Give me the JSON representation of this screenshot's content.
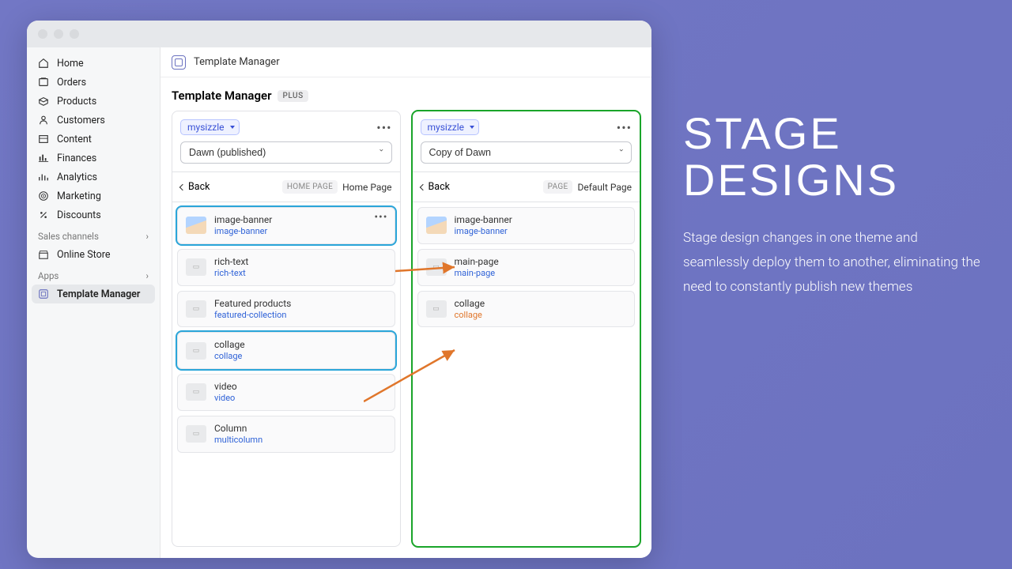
{
  "header": {
    "appName": "Template Manager"
  },
  "subheader": {
    "title": "Template Manager",
    "badge": "PLUS"
  },
  "sidebar": {
    "primary": [
      {
        "label": "Home",
        "icon": "home"
      },
      {
        "label": "Orders",
        "icon": "orders"
      },
      {
        "label": "Products",
        "icon": "products"
      },
      {
        "label": "Customers",
        "icon": "customers"
      },
      {
        "label": "Content",
        "icon": "content"
      },
      {
        "label": "Finances",
        "icon": "finances"
      },
      {
        "label": "Analytics",
        "icon": "analytics"
      },
      {
        "label": "Marketing",
        "icon": "marketing"
      },
      {
        "label": "Discounts",
        "icon": "discounts"
      }
    ],
    "channelsLabel": "Sales channels",
    "channels": [
      {
        "label": "Online Store"
      }
    ],
    "appsLabel": "Apps",
    "apps": [
      {
        "label": "Template Manager",
        "active": true
      }
    ]
  },
  "panels": {
    "left": {
      "store": "mysizzle",
      "theme": "Dawn (published)",
      "backLabel": "Back",
      "tag": "HOME PAGE",
      "pageName": "Home Page",
      "sections": [
        {
          "name": "image-banner",
          "sub": "image-banner",
          "thumb": "img",
          "hl": true,
          "dots": true
        },
        {
          "name": "rich-text",
          "sub": "rich-text",
          "thumb": "plain"
        },
        {
          "name": "Featured products",
          "sub": "featured-collection",
          "thumb": "plain"
        },
        {
          "name": "collage",
          "sub": "collage",
          "thumb": "plain",
          "hl": true
        },
        {
          "name": "video",
          "sub": "video",
          "thumb": "plain"
        },
        {
          "name": "Column",
          "sub": "multicolumn",
          "thumb": "plain"
        }
      ]
    },
    "right": {
      "store": "mysizzle",
      "theme": "Copy of Dawn",
      "backLabel": "Back",
      "tag": "PAGE",
      "pageName": "Default Page",
      "sections": [
        {
          "name": "image-banner",
          "sub": "image-banner",
          "thumb": "img"
        },
        {
          "name": "main-page",
          "sub": "main-page",
          "thumb": "plain"
        },
        {
          "name": "collage",
          "sub": "collage",
          "thumb": "plain",
          "subColor": "orange"
        }
      ]
    }
  },
  "promo": {
    "title1": "STAGE",
    "title2": "DESIGNS",
    "body": "Stage design changes in one theme and seamlessly deploy them to another, eliminating the need to constantly publish new themes"
  }
}
